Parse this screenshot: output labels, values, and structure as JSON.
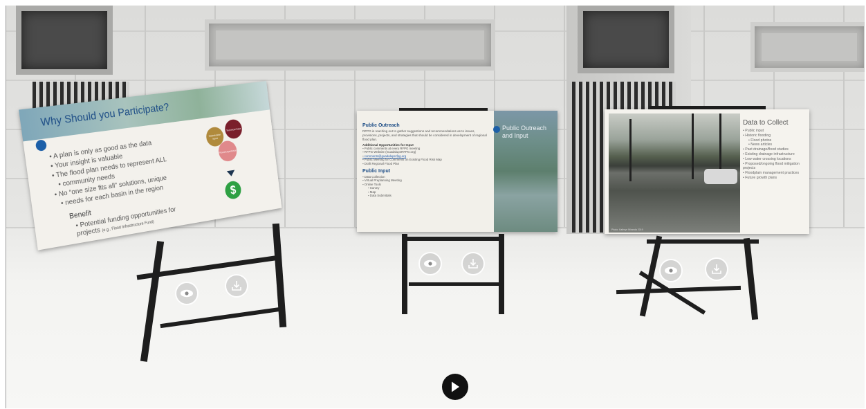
{
  "scene": {
    "board1": {
      "title": "Why Should you Participate?",
      "bullets": [
        "A plan is only as good as the data",
        "Your insight is valuable",
        "The flood plan needs to represent ALL",
        "community needs",
        "No “one size fits all” solutions, unique",
        "needs for each basin in the region"
      ],
      "benefit_heading": "Benefit",
      "benefit_line1": "• Potential funding opportunities for",
      "benefit_line2": "projects",
      "benefit_note": "(e.g., Flood Infrastructure Fund)",
      "circle_labels": [
        "Stakeholder Input",
        "Technical Data",
        "Flood Experience"
      ],
      "dollar_symbol": "$"
    },
    "board2": {
      "title": "Public Outreach and Input",
      "section1_heading": "Public Outreach",
      "section1_text": "RFPG is reaching out to gather suggestions and recommendations as to issues, provisions, projects, and strategies that should be considered in development of regional flood plan.",
      "section1_sub": "Additional Opportunities for Input",
      "section1_items": [
        "Public comments at every RFPG meeting",
        "RFPG Website (GuadalupeRFPG.org)",
        "comments@guadaluperfpg.org",
        "Public Meeting for Comments on Existing Flood Risk Map",
        "Draft Regional Flood Plan"
      ],
      "section2_heading": "Public Input",
      "section2_items": [
        "Data Collection",
        "Virtual Preplanning Meeting",
        "Online Tools",
        "Survey",
        "Map",
        "Data Submittals"
      ]
    },
    "board3": {
      "title": "Data to Collect",
      "items": [
        "Public input",
        "Historic flooding",
        "Flood photos",
        "News articles",
        "Past drainage/flood studies",
        "Existing drainage infrastructure",
        "Low water crossing locations",
        "Proposed/ongoing flood mitigation projects",
        "Floodplain management practices",
        "Future growth plans"
      ],
      "sub_items": [
        "Flood photos",
        "News articles"
      ],
      "photo_credit": "Photo: Kathryn Miranda 2019"
    }
  },
  "controls": {
    "view_icon": "eye-icon",
    "download_icon": "download-icon",
    "play_icon": "play-icon"
  }
}
